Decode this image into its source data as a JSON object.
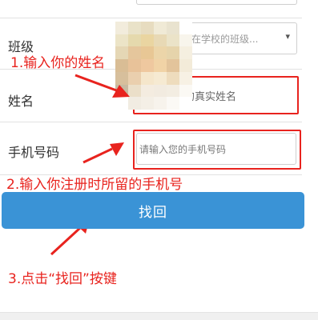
{
  "form": {
    "class_label": "班级",
    "class_placeholder": "所在学校的班级...",
    "name_label": "姓名",
    "name_placeholder": "的真实姓名",
    "phone_label": "手机号码",
    "phone_placeholder": "请输入您的手机号码",
    "submit_label": "找回"
  },
  "annotations": {
    "step1": "1.输入你的姓名",
    "step2": "2.输入你注册时所留的手机号",
    "step3": "3.点击“找回”按键"
  },
  "colors": {
    "annotation_red": "#e8231e",
    "button_blue": "#3a93d6"
  },
  "icons": {
    "select_arrow": "chevron-down-icon"
  }
}
